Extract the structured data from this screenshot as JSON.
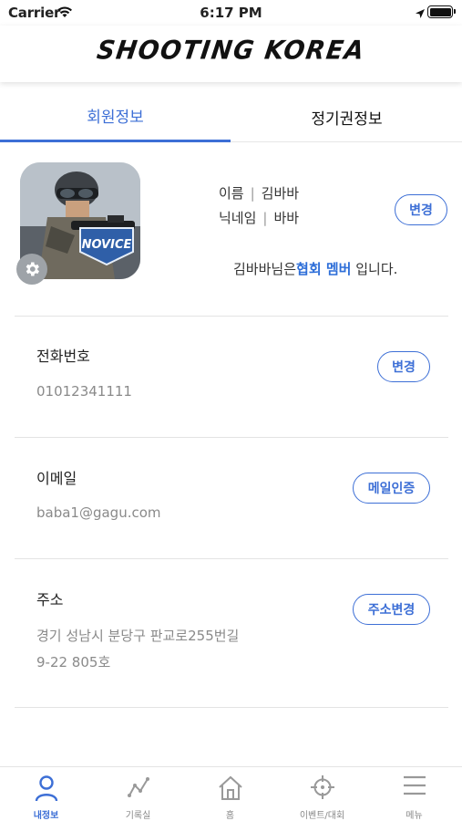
{
  "status_bar": {
    "carrier": "Carrier",
    "time": "6:17 PM"
  },
  "header": {
    "logo_text": "SHOOTING KOREA"
  },
  "tabs": [
    {
      "label": "회원정보",
      "active": true
    },
    {
      "label": "정기권정보",
      "active": false
    }
  ],
  "profile": {
    "name_label": "이름",
    "name_value": "김바바",
    "nick_label": "닉네임",
    "nick_value": "바바",
    "change_label": "변경",
    "member_prefix": "김바바님은",
    "member_highlight": "협회 멤버",
    "member_suffix": " 입니다.",
    "badge_text": "NOVICE"
  },
  "phone": {
    "label": "전화번호",
    "value": "01012341111",
    "button": "변경"
  },
  "email": {
    "label": "이메일",
    "value": "baba1@gagu.com",
    "button": "메일인증"
  },
  "address": {
    "label": "주소",
    "line1": "경기 성남시 분당구 판교로255번길",
    "line2": "9-22 805호",
    "button": "주소변경"
  },
  "bottom_nav": [
    {
      "label": "내정보",
      "icon": "person-icon",
      "active": true
    },
    {
      "label": "기록실",
      "icon": "chart-line-icon",
      "active": false
    },
    {
      "label": "홈",
      "icon": "home-icon",
      "active": false
    },
    {
      "label": "이벤트/대회",
      "icon": "crosshair-icon",
      "active": false
    },
    {
      "label": "메뉴",
      "icon": "menu-icon",
      "active": false
    }
  ],
  "colors": {
    "accent": "#3d6fd6",
    "highlight": "#2d6ed8",
    "muted": "#8a8a8a"
  }
}
